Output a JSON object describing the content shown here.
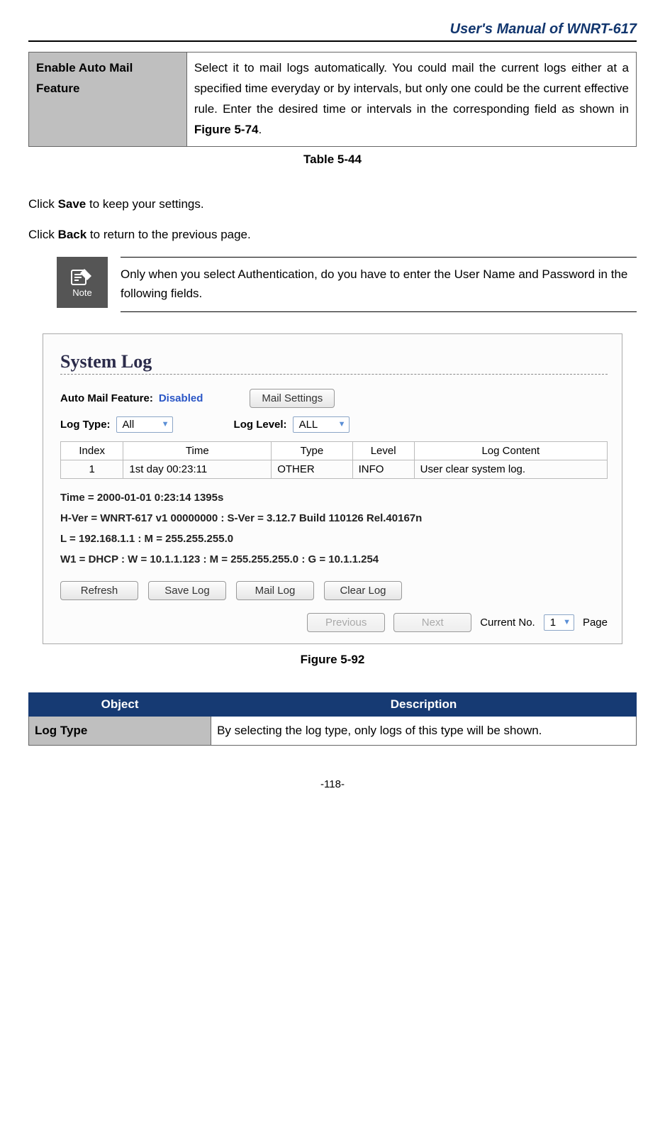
{
  "header": {
    "title": "User's  Manual  of  WNRT-617"
  },
  "top_table": {
    "object": "Enable Auto Mail Feature",
    "desc_prefix": "Select it to mail logs automatically. You could mail the current logs either at a specified time everyday or by intervals, but only one could be the current effective rule. Enter the desired time or intervals in the corresponding field as shown in ",
    "desc_fig_ref": "Figure 5-74",
    "desc_suffix": "."
  },
  "table_caption": "Table 5-44",
  "body1_pre": "Click ",
  "body1_bold": "Save",
  "body1_post": " to keep your settings.",
  "body2_pre": "Click ",
  "body2_bold": "Back",
  "body2_post": " to return to the previous page.",
  "note": {
    "label": "Note",
    "text": "Only when you select Authentication, do you have to enter the User Name and Password in the following fields."
  },
  "syslog": {
    "title": "System Log",
    "auto_mail_label": "Auto Mail Feature:",
    "auto_mail_value": "Disabled",
    "mail_settings_btn": "Mail Settings",
    "log_type_label": "Log Type:",
    "log_type_value": "All",
    "log_level_label": "Log Level:",
    "log_level_value": "ALL",
    "cols": {
      "index": "Index",
      "time": "Time",
      "type": "Type",
      "level": "Level",
      "content": "Log Content"
    },
    "rows": [
      {
        "index": "1",
        "time": "1st day 00:23:11",
        "type": "OTHER",
        "level": "INFO",
        "content": "User clear system log."
      }
    ],
    "info1": "Time = 2000-01-01 0:23:14 1395s",
    "info2": "H-Ver = WNRT-617 v1 00000000 : S-Ver = 3.12.7 Build 110126 Rel.40167n",
    "info3": "L = 192.168.1.1 : M = 255.255.255.0",
    "info4": "W1 = DHCP : W = 10.1.1.123 : M = 255.255.255.0 : G = 10.1.1.254",
    "btn_refresh": "Refresh",
    "btn_save": "Save Log",
    "btn_mail": "Mail Log",
    "btn_clear": "Clear Log",
    "btn_prev": "Previous",
    "btn_next": "Next",
    "current_no_label": "Current No.",
    "current_no_value": "1",
    "page_suffix": "Page"
  },
  "figure_caption": "Figure 5-92",
  "obj_table": {
    "col_object": "Object",
    "col_desc": "Description",
    "rows": [
      {
        "object": "Log Type",
        "desc": "By selecting the log type, only logs of this type will be shown."
      }
    ]
  },
  "page_number": "-118-"
}
